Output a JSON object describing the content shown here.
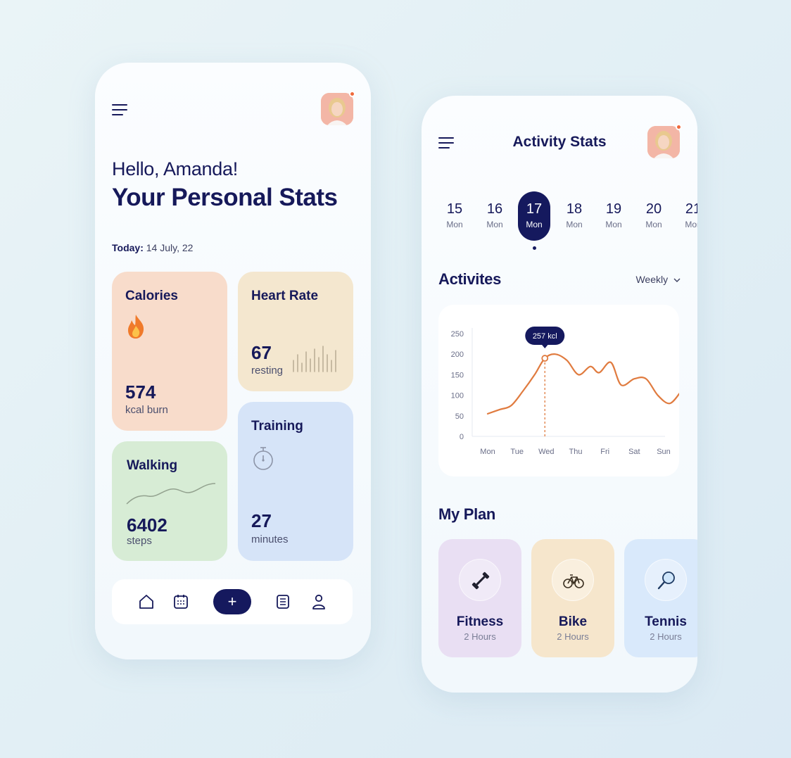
{
  "left_screen": {
    "greeting": "Hello, Amanda!",
    "title": "Your Personal Stats",
    "today_label": "Today:",
    "today_value": "14 July, 22",
    "cards": {
      "calories": {
        "title": "Calories",
        "value": "574",
        "sub": "kcal burn",
        "icon": "flame-icon",
        "color": "#f8dccb"
      },
      "heart_rate": {
        "title": "Heart Rate",
        "value": "67",
        "sub": "resting",
        "icon": "heartbeat-bars",
        "color": "#f4e7cf"
      },
      "training": {
        "title": "Training",
        "value": "27",
        "sub": "minutes",
        "icon": "stopwatch-icon",
        "color": "#d6e4f8"
      },
      "walking": {
        "title": "Walking",
        "value": "6402",
        "sub": "steps",
        "icon": "wave-line",
        "color": "#d7ecd5"
      }
    },
    "nav": {
      "items": [
        "home-icon",
        "calendar-icon",
        "add-button",
        "notes-icon",
        "profile-icon"
      ],
      "add_label": "+"
    }
  },
  "right_screen": {
    "title": "Activity Stats",
    "days": [
      {
        "num": "15",
        "wd": "Mon"
      },
      {
        "num": "16",
        "wd": "Mon"
      },
      {
        "num": "17",
        "wd": "Mon",
        "active": true
      },
      {
        "num": "18",
        "wd": "Mon"
      },
      {
        "num": "19",
        "wd": "Mon"
      },
      {
        "num": "20",
        "wd": "Mon"
      },
      {
        "num": "21",
        "wd": "Mon"
      }
    ],
    "activities_title": "Activites",
    "filter_label": "Weekly",
    "plan_title": "My Plan",
    "plans": [
      {
        "name": "Fitness",
        "sub": "2 Hours",
        "icon": "dumbbell-icon",
        "color": "#e9dff3"
      },
      {
        "name": "Bike",
        "sub": "2 Hours",
        "icon": "bicycle-icon",
        "color": "#f6e6cc"
      },
      {
        "name": "Tennis",
        "sub": "2 Hours",
        "icon": "tennis-racket-icon",
        "color": "#d9e9fb"
      }
    ]
  },
  "accent_color": "#15195e",
  "chart_accent_color": "#e07b3f",
  "chart_data": {
    "type": "line",
    "categories": [
      "Mon",
      "Tue",
      "Wed",
      "Thu",
      "Fri",
      "Sat",
      "Sun"
    ],
    "y_ticks": [
      "250",
      "200",
      "150",
      "100",
      "50",
      "0"
    ],
    "ylim": [
      0,
      250
    ],
    "series": [
      {
        "x": [
          0,
          0.4,
          0.8,
          1.2,
          1.6,
          1.95,
          2.3,
          2.7,
          3.1,
          3.5,
          3.8,
          4.2,
          4.55,
          5.0,
          5.4,
          5.8,
          6.2,
          6.55
        ],
        "values": [
          55,
          65,
          75,
          110,
          150,
          190,
          200,
          185,
          150,
          170,
          155,
          180,
          125,
          140,
          140,
          100,
          80,
          105
        ]
      }
    ],
    "highlight": {
      "label": "257 kcl",
      "x": 1.95,
      "y": 190
    },
    "grid": false
  }
}
